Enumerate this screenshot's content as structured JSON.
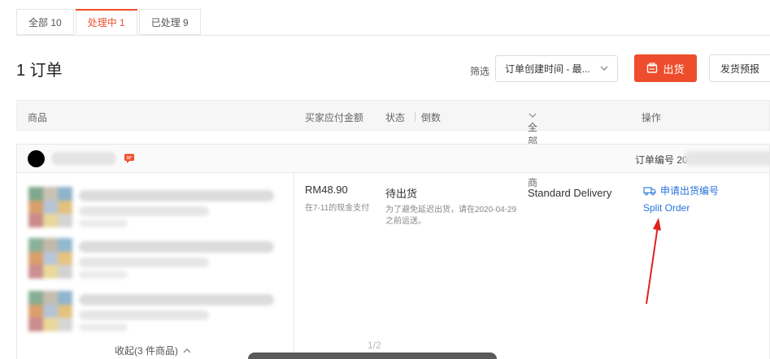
{
  "tabs": [
    {
      "label": "全部 10",
      "active": false
    },
    {
      "label": "处理中 1",
      "active": true
    },
    {
      "label": "已处理 9",
      "active": false
    }
  ],
  "page": {
    "title": "1 订单"
  },
  "toolbar": {
    "filter_label": "筛选",
    "filter_value": "订单创建时间 - 最...",
    "ship_label": "出货",
    "forecast_label": "发货预报"
  },
  "table_header": {
    "product": "商品",
    "amount": "买家应付金额",
    "status": "状态",
    "countdown": "倒数",
    "carrier": "全部物流商",
    "actions": "操作"
  },
  "order": {
    "order_no_label": "订单编号 20",
    "price": "RM48.90",
    "payment_method": "在7-11的现金支付",
    "status": "待出货",
    "status_note": "为了避免延迟出货，请在2020-04-29之前运送。",
    "carrier": "Standard Delivery",
    "action_request": "申请出货编号",
    "action_split": "Split Order",
    "collapse_label": "收起(3 件商品)",
    "page_indicator": "1/2"
  },
  "colors": {
    "accent": "#ee4d2d",
    "link": "#2673dd",
    "annotation": "#e02020"
  },
  "icons": [
    "chat-icon",
    "ship-icon",
    "truck-icon",
    "chevron-down-icon",
    "chevron-up-icon"
  ]
}
